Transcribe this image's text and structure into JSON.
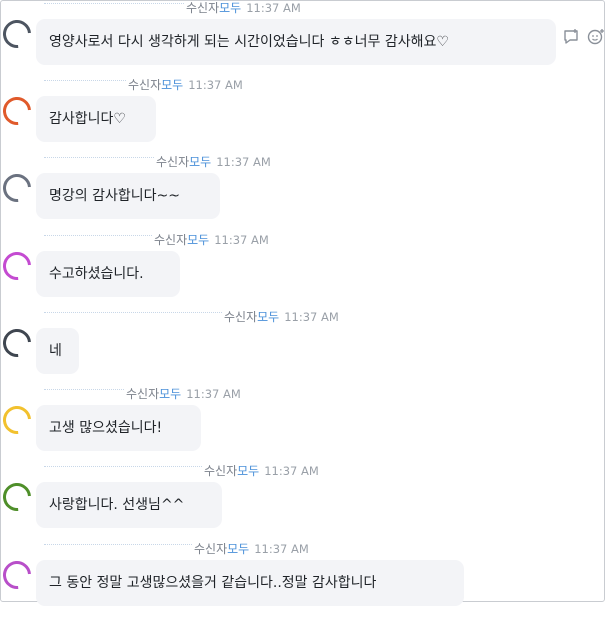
{
  "chat": {
    "receiver_label": "수신자",
    "all_label": "모두",
    "messages": [
      {
        "time": "11:37 AM",
        "text": "영양사로서 다시 생각하게 되는 시간이었습니다 ㅎㅎ너무 감사해요♡",
        "avatar_color": "#4d5561"
      },
      {
        "time": "11:37 AM",
        "text": "감사합니다♡",
        "avatar_color": "#e05a2b"
      },
      {
        "time": "11:37 AM",
        "text": "명강의 감사합니다~~",
        "avatar_color": "#6b7280"
      },
      {
        "time": "11:37 AM",
        "text": "수고하셨습니다.",
        "avatar_color": "#c44bd1"
      },
      {
        "time": "11:37 AM",
        "text": "네",
        "avatar_color": "#3f4650"
      },
      {
        "time": "11:37 AM",
        "text": "고생 많으셨습니다!",
        "avatar_color": "#f2c12e"
      },
      {
        "time": "11:37 AM",
        "text": "사랑합니다. 선생님^^",
        "avatar_color": "#4f8f2a"
      },
      {
        "time": "11:37 AM",
        "text": "그 동안 정말 고생많으셨을거 같습니다..정말 감사합니다",
        "avatar_color": "#b84fc9"
      }
    ],
    "actions": {
      "reply_icon": "reply-bubble-icon",
      "emoji_icon": "emoji-add-icon"
    }
  }
}
